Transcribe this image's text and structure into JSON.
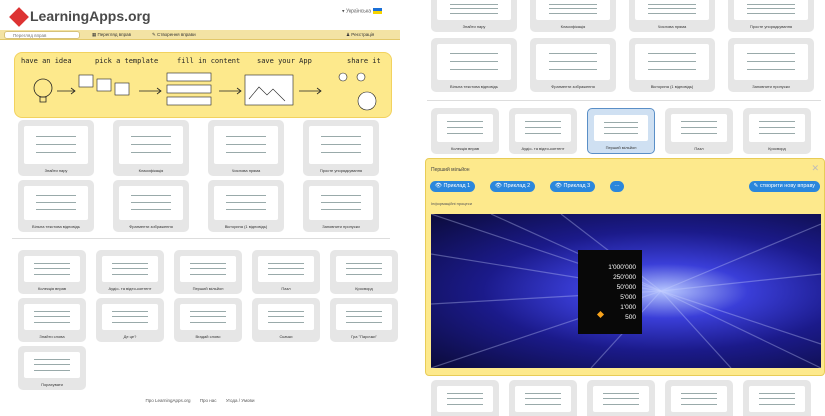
{
  "left": {
    "logo": "LearningApps.org",
    "language": "Українська",
    "nav": {
      "search_placeholder": "Перегляд вправ",
      "browse": "Перегляд вправ",
      "create": "Створення вправи",
      "register": "Реєстрація"
    },
    "banner": {
      "steps": [
        "have an idea",
        "pick a template",
        "fill in content",
        "save your App",
        "share it"
      ]
    },
    "templates_row1": [
      "Знайти пару",
      "Класифікація",
      "Числова пряма",
      "Просте упорядкування"
    ],
    "templates_row2": [
      "Вільна текстова відповідь",
      "Фрагменти зображення",
      "Вікторина (1 відповідь)",
      "Заповнити пропуски"
    ],
    "templates_row3": [
      "Колекція вправ",
      "Аудіо- та відео-контент",
      "Перший мільйон",
      "Пазл",
      "Кросворд"
    ],
    "templates_row4": [
      "Знайти слова",
      "Де це?",
      "Вгадай слово",
      "Скачки",
      "Гра \"Парочки\""
    ],
    "templates_row5": [
      "Порахувати"
    ],
    "footer": [
      "Про LearningApps.org",
      "Про нас",
      "Угода / Умови"
    ]
  },
  "right": {
    "templates_top": [
      "Знайти пару",
      "Класифікація",
      "Числова пряма",
      "Просте упорядкування"
    ],
    "templates_row2": [
      "Вільна текстова відповідь",
      "Фрагменти зображення",
      "Вікторина (1 відповідь)",
      "Заповнити пропуски"
    ],
    "templates_row3": [
      "Колекція вправ",
      "Аудіо- та відео-контент",
      "Перший мільйон",
      "Пазл",
      "Кросворд"
    ],
    "modal": {
      "title": "Перший мільйон",
      "close": "✕",
      "examples": [
        "Приклад 1",
        "Приклад 2",
        "Приклад 3"
      ],
      "more": "···",
      "create_new": "створити нову вправу",
      "info": "Інформаційні процеси",
      "ladder": [
        "1'000'000",
        "250'000",
        "50'000",
        "5'000",
        "1'000",
        "500"
      ]
    }
  },
  "colors": {
    "banner": "#fde98c",
    "nav": "#f3e3a4",
    "button": "#2b87dc",
    "tile": "#e6e6e6"
  }
}
